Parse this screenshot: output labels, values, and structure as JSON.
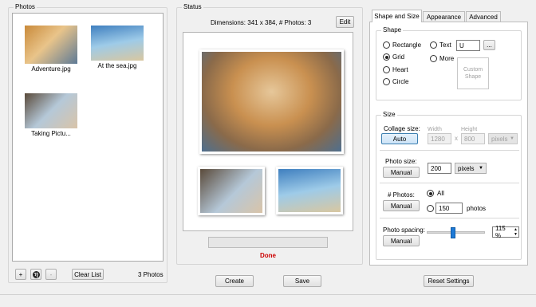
{
  "photos_panel": {
    "title": "Photos",
    "thumbnails": [
      {
        "name": "Adventure.jpg",
        "colors": [
          "#c98a3a",
          "#e9c48a",
          "#5e7a96"
        ]
      },
      {
        "name": "At the sea.jpg",
        "colors": [
          "#3f7fbf",
          "#9ecbe8",
          "#d9c7a0"
        ]
      },
      {
        "name": "Taking Pictu...",
        "colors": [
          "#5a4a3a",
          "#b5c8d8",
          "#d9c4a8"
        ]
      }
    ],
    "add_button": "+",
    "clear_button": "Clear List",
    "remove_button": "-",
    "photo_count": "3 Photos"
  },
  "status_panel": {
    "title": "Status",
    "dimensions": "Dimensions: 341 x 384, # Photos: 3",
    "edit_button": "Edit",
    "status_text": "Done",
    "status_color": "#cc0000"
  },
  "tabs": [
    "Shape and Size",
    "Appearance",
    "Advanced"
  ],
  "shape": {
    "title": "Shape",
    "options": [
      "Rectangle",
      "Grid",
      "Heart",
      "Circle"
    ],
    "selected": "Grid",
    "text_label": "Text",
    "text_value": "U",
    "browse_button": "...",
    "more_label": "More",
    "custom_shape_label": "Custom Shape"
  },
  "size": {
    "title": "Size",
    "collage_size_label": "Collage size:",
    "collage_size_button": "Auto",
    "width_label": "Width",
    "height_label": "Height",
    "width_value": "1280",
    "height_value": "800",
    "times": "x",
    "collage_unit": "pixels",
    "photo_size_label": "Photo size:",
    "photo_size_button": "Manual",
    "photo_size_value": "200",
    "photo_size_unit": "pixels",
    "num_photos_label": "# Photos:",
    "num_photos_button": "Manual",
    "all_label": "All",
    "num_photos_value": "150",
    "photos_suffix": "photos",
    "spacing_label": "Photo spacing:",
    "spacing_button": "Manual",
    "spacing_value": "115 %",
    "spacing_level": 0.45
  },
  "bottom": {
    "create_button": "Create",
    "save_button": "Save",
    "reset_button": "Reset Settings"
  }
}
